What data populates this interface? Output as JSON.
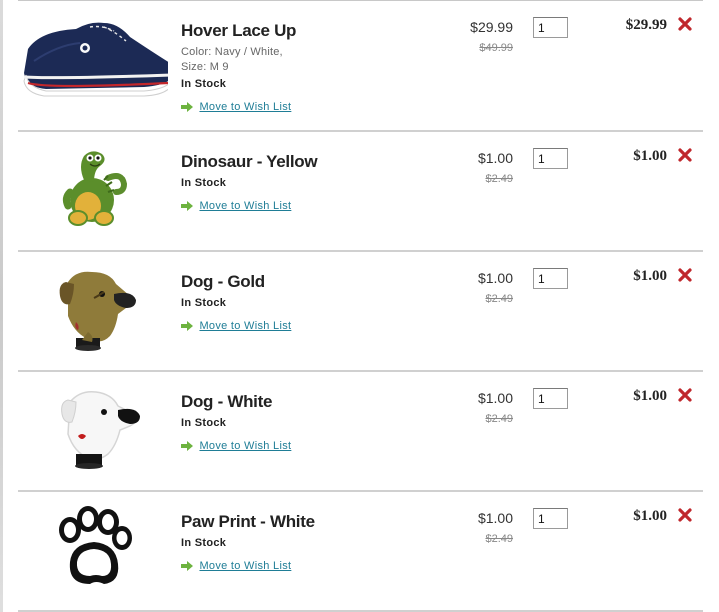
{
  "cart": {
    "wish_label": "Move to Wish List",
    "items": [
      {
        "name": "Hover Lace Up",
        "color_line": "Color: Navy / White,",
        "size_line": "Size: M 9",
        "stock": "In Stock",
        "price": "$29.99",
        "was": "$49.99",
        "qty": "1",
        "total": "$29.99",
        "image": "navy-canvas-sneaker"
      },
      {
        "name": "Dinosaur - Yellow",
        "stock": "In Stock",
        "price": "$1.00",
        "was": "$2.49",
        "qty": "1",
        "total": "$1.00",
        "image": "dinosaur-charm"
      },
      {
        "name": "Dog - Gold",
        "stock": "In Stock",
        "price": "$1.00",
        "was": "$2.49",
        "qty": "1",
        "total": "$1.00",
        "image": "gold-dog-charm"
      },
      {
        "name": "Dog - White",
        "stock": "In Stock",
        "price": "$1.00",
        "was": "$2.49",
        "qty": "1",
        "total": "$1.00",
        "image": "white-dog-charm"
      },
      {
        "name": "Paw Print - White",
        "stock": "In Stock",
        "price": "$1.00",
        "was": "$2.49",
        "qty": "1",
        "total": "$1.00",
        "image": "paw-print-charm"
      }
    ]
  },
  "colors": {
    "link": "#1f7d96",
    "wish_arrow": "#6db33f",
    "remove_x": "#c0282d",
    "divider": "#d0d0d0"
  },
  "icons": {
    "wish": "green-right-arrow-icon",
    "remove": "red-x-icon"
  }
}
